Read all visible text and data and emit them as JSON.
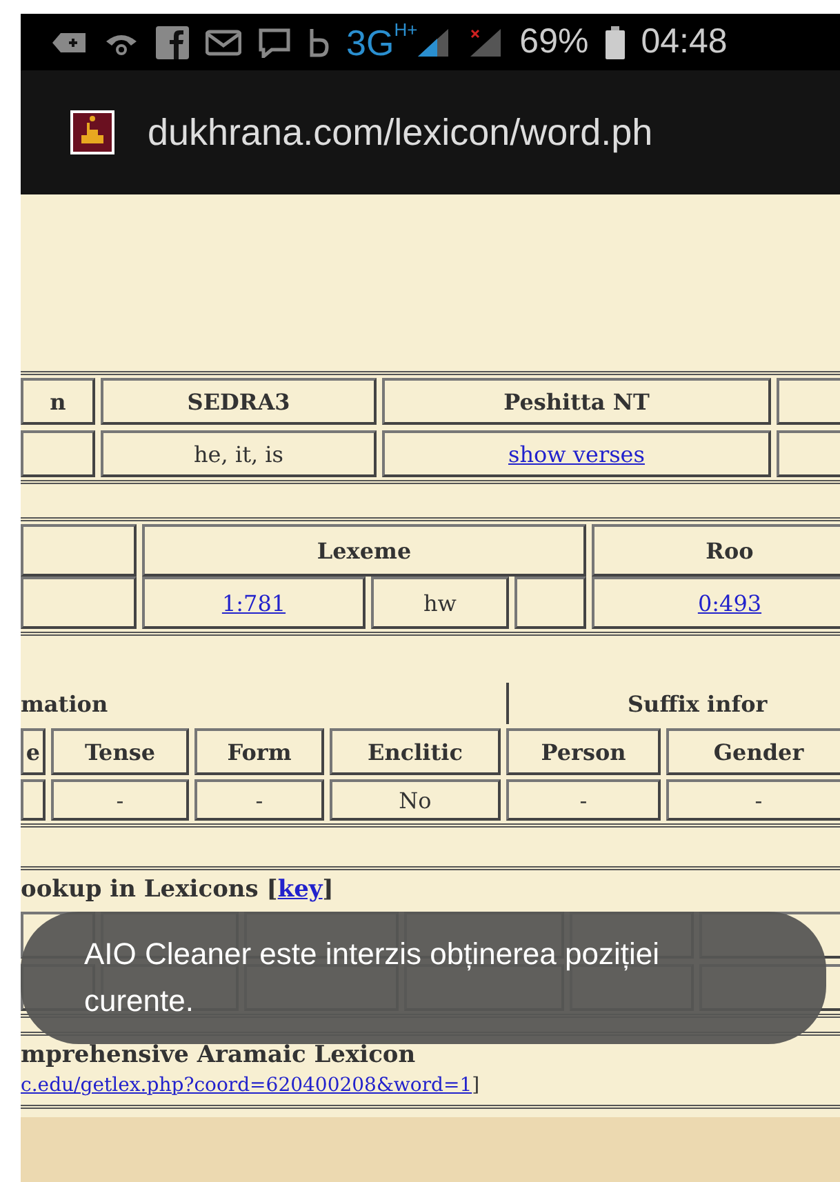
{
  "status_bar": {
    "network": "3G",
    "network_sub": "H+",
    "battery": "69%",
    "time": "04:48"
  },
  "address_bar": {
    "url": "dukhrana.com/lexicon/word.ph"
  },
  "translation_table": {
    "headers": [
      {
        "text": "n"
      },
      {
        "text": "SEDRA3"
      },
      {
        "text": "Peshitta NT"
      }
    ],
    "row": [
      {
        "kind": "empty"
      },
      {
        "kind": "text",
        "text": "he, it, is"
      },
      {
        "kind": "link",
        "text": "show verses"
      },
      {
        "kind": "empty"
      }
    ]
  },
  "lexeme_table": {
    "headers": [
      {
        "text": "Lexeme"
      },
      {
        "text": "Roo"
      }
    ],
    "row": [
      {
        "kind": "empty"
      },
      {
        "kind": "link",
        "text": "1:781"
      },
      {
        "kind": "text",
        "text": "hw"
      },
      {
        "kind": "empty"
      },
      {
        "kind": "link",
        "text": "0:493"
      }
    ]
  },
  "grammar_table": {
    "groups": [
      {
        "text": "mation"
      },
      {
        "text": "Suffix infor"
      }
    ],
    "headers": [
      {
        "text": "e"
      },
      {
        "text": "Tense"
      },
      {
        "text": "Form"
      },
      {
        "text": "Enclitic"
      },
      {
        "text": "Person"
      },
      {
        "text": "Gender"
      }
    ],
    "row": [
      {
        "kind": "empty"
      },
      {
        "kind": "text",
        "text": "-"
      },
      {
        "kind": "text",
        "text": "-"
      },
      {
        "kind": "text",
        "text": "No"
      },
      {
        "kind": "text",
        "text": "-"
      },
      {
        "kind": "text",
        "text": "-"
      }
    ]
  },
  "lookup": {
    "title": "ookup in Lexicons [",
    "title_link": "key",
    "title_end": "]"
  },
  "cal": {
    "title": "mprehensive Aramaic Lexicon",
    "link": "c.edu/getlex.php?coord=620400208&word=1",
    "link_end": "]"
  },
  "toast": {
    "message": "AIO Cleaner este interzis obținerea poziției curente."
  }
}
